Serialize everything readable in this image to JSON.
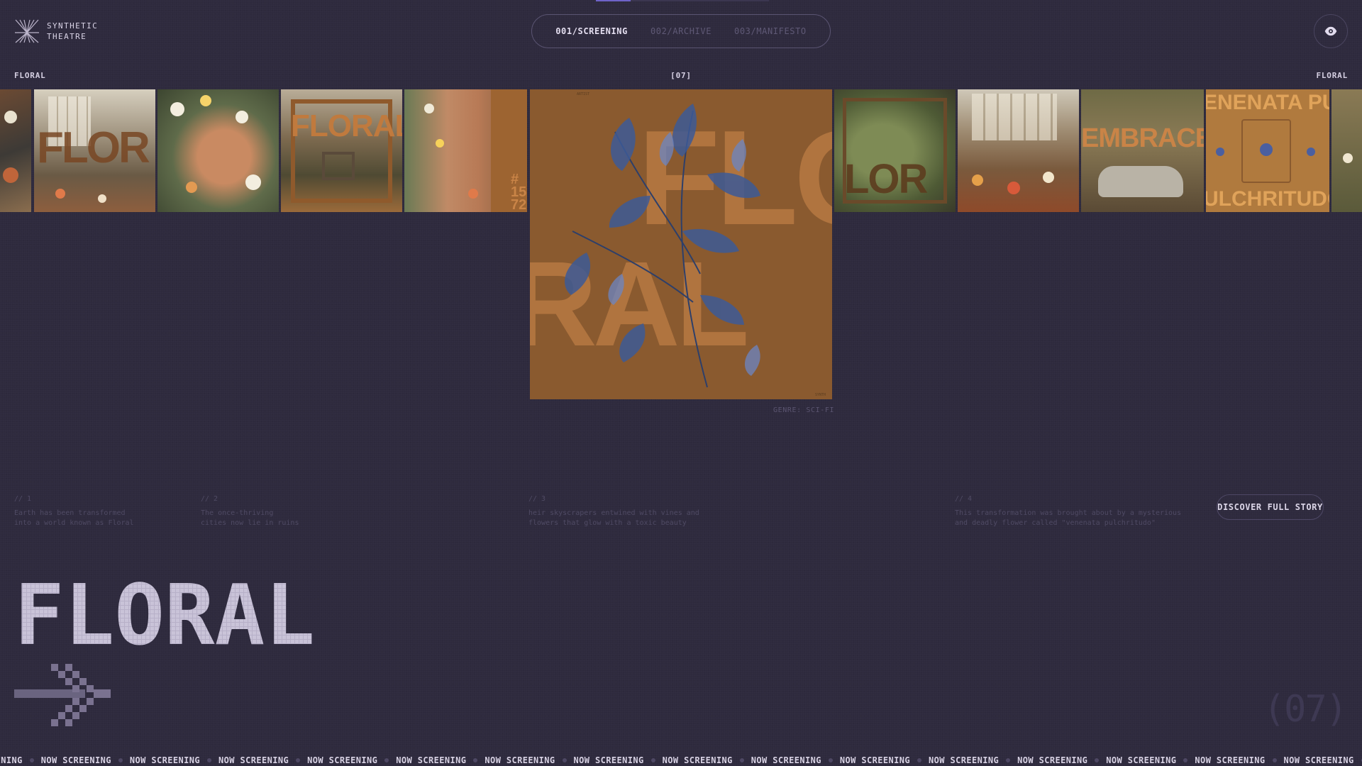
{
  "brand": {
    "line1": "SYNTHETIC",
    "line2": "THEATRE"
  },
  "nav": {
    "items": [
      {
        "label": "001/SCREENING",
        "active": true
      },
      {
        "label": "002/ARCHIVE",
        "active": false
      },
      {
        "label": "003/MANIFESTO",
        "active": false
      }
    ]
  },
  "progress": {
    "fraction": 0.2
  },
  "labels": {
    "left": "FLORAL",
    "center": "[07]",
    "right": "FLORAL"
  },
  "thumbnails": {
    "t2": "FLOR",
    "t4": "FLORAL",
    "t5_number": "#\n15\n72",
    "t7": "LOR",
    "t9": "EMBRACE",
    "t10_top": "ENENATA PUL",
    "t10_bottom": "ULCHRITUDO"
  },
  "poster": {
    "text_top": "FLO",
    "text_bottom": "RAL"
  },
  "genre": "GENRE: SCI-FI",
  "story": [
    {
      "num": "// 1",
      "text": "Earth has been transformed\ninto a world known as Floral"
    },
    {
      "num": "// 2",
      "text": "The once-thriving\ncities now lie in ruins"
    },
    {
      "num": "// 3",
      "text": "heir skyscrapers entwined with vines and\nflowers that glow with a toxic beauty"
    },
    {
      "num": "// 4",
      "text": "This transformation was brought about by a mysterious\nand deadly flower called \"venenata pulchritudo\""
    }
  ],
  "discover_button": "DISCOVER FULL STORY",
  "title": "FLORAL",
  "counter": "(07)",
  "marquee": {
    "text": "NOW SCREENING",
    "head": "EENING"
  },
  "colors": {
    "background": "#2e2a3d",
    "accent": "#6f63c9",
    "poster": "#8a5a2f",
    "poster_text": "#b0743f",
    "title": "#c9c3d8"
  }
}
